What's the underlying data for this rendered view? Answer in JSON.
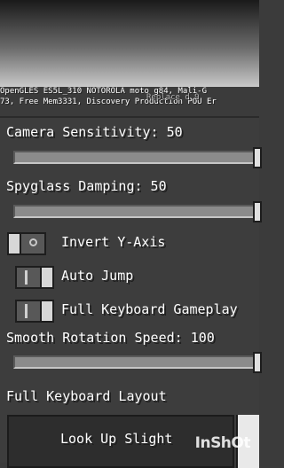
{
  "debug": {
    "line1": "OpenGLES ES5L_310 NOTOROLA moto g84, Mali-G",
    "line2": "73, Free Mem3331, Discovery Production POU Er",
    "overlay": "Replace d 9"
  },
  "settings": {
    "camera_sensitivity": {
      "label": "Camera Sensitivity: 50",
      "value": 50
    },
    "spyglass_damping": {
      "label": "Spyglass Damping: 50",
      "value": 50
    },
    "invert_y_axis": {
      "label": "Invert Y-Axis",
      "on": false
    },
    "auto_jump": {
      "label": "Auto Jump",
      "on": true
    },
    "full_keyboard_gameplay": {
      "label": "Full Keyboard Gameplay",
      "on": true
    },
    "smooth_rotation_speed": {
      "label": "Smooth Rotation Speed: 100",
      "value": 100
    },
    "full_keyboard_layout": {
      "label": "Full Keyboard Layout"
    },
    "look_up_slight": {
      "label": "Look Up Slight"
    }
  },
  "watermark": "InShOt"
}
